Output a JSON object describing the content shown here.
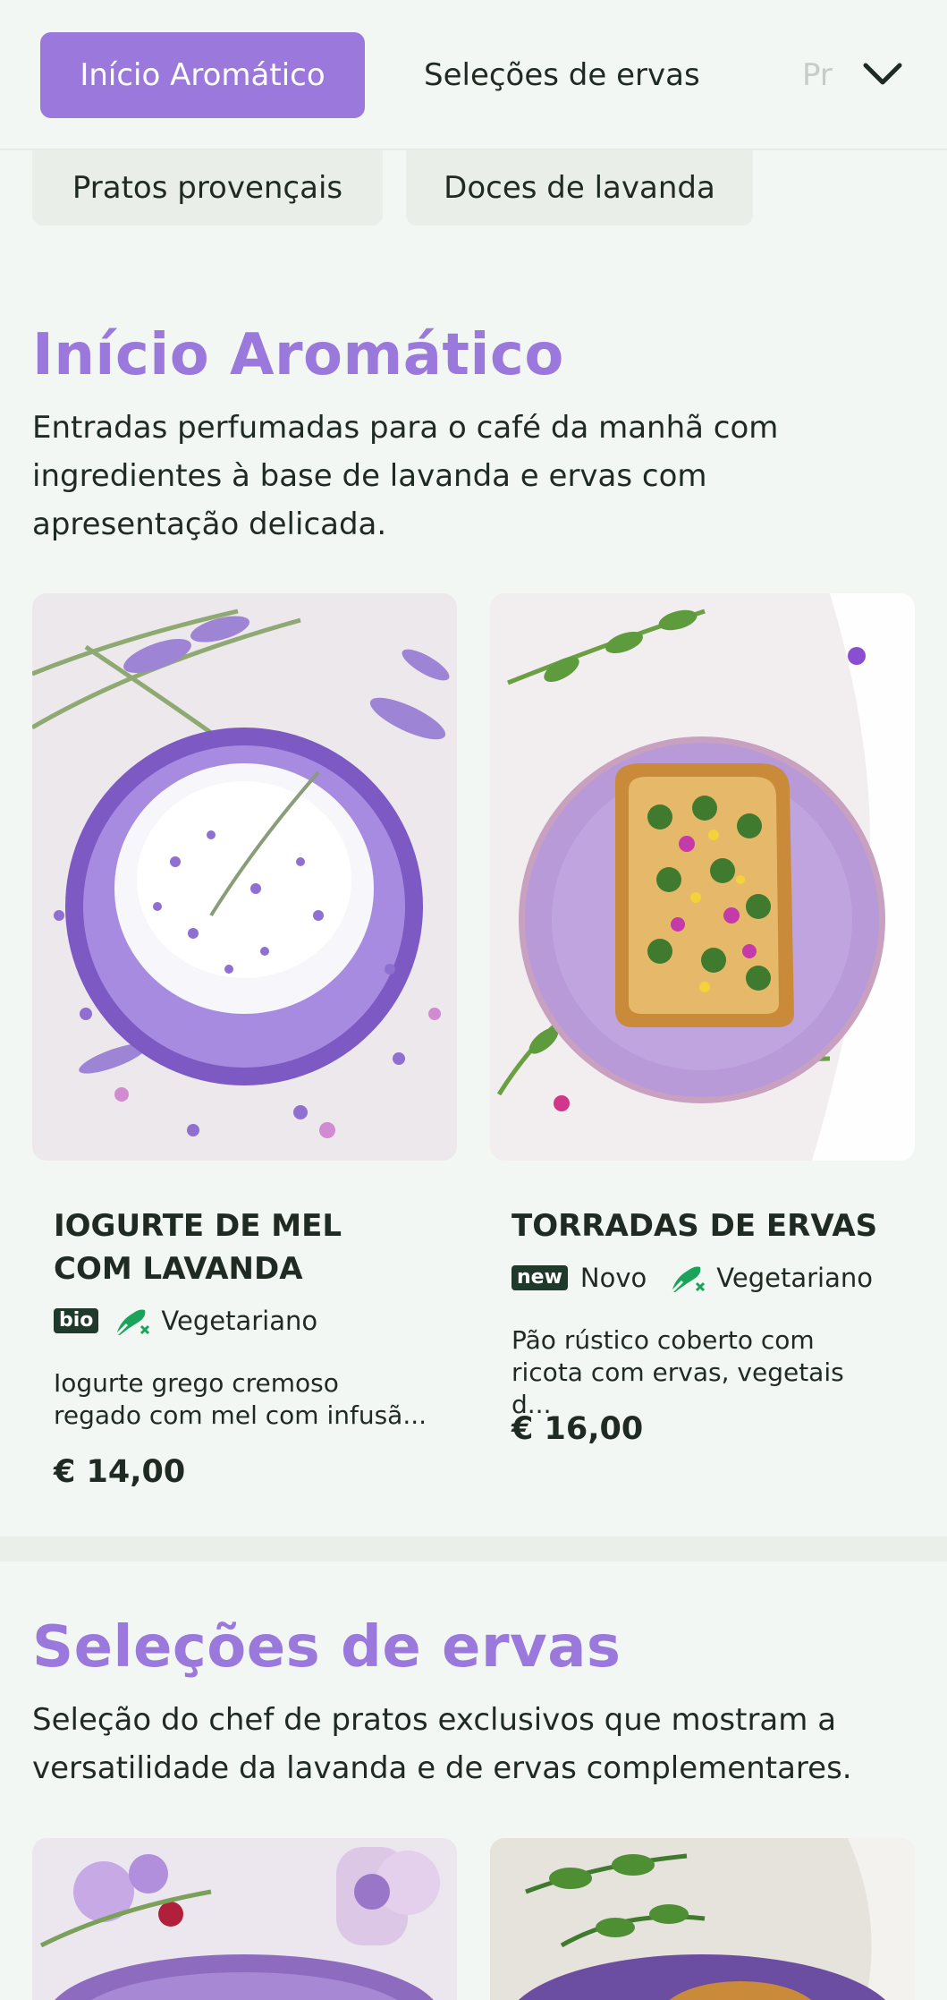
{
  "nav": {
    "tabs": [
      {
        "label": "Início Aromático",
        "active": true
      },
      {
        "label": "Seleções de ervas"
      },
      {
        "label": "Pr"
      }
    ],
    "more_icon": "chevron-down-icon",
    "chips": [
      "Pratos provençais",
      "Doces de lavanda"
    ]
  },
  "sections": [
    {
      "title": "Início Aromático",
      "description": "Entradas perfumadas para o café da manhã com ingredientes à base de lavanda e ervas com apresentação delicada.",
      "items": [
        {
          "name": "IOGURTE DE MEL COM LAVANDA",
          "badge": "bio",
          "tag": "Vegetariano",
          "description": "Iogurte grego cremoso regado com mel com infusã...",
          "price": "€ 14,00"
        },
        {
          "name": "TORRADAS DE ERVAS",
          "badge": "new",
          "badge_label": "Novo",
          "tag": "Vegetariano",
          "description": "Pão rústico coberto com ricota com ervas, vegetais d...",
          "price": "€ 16,00"
        }
      ]
    },
    {
      "title": "Seleções de ervas",
      "description": "Seleção do chef de pratos exclusivos que mostram a versatilidade da lavanda e de ervas complementares."
    }
  ],
  "colors": {
    "accent": "#9b79dc",
    "background": "#f3f7f3",
    "vegetarian_icon": "#19a35b",
    "badge_bg": "#1f3a2a"
  }
}
